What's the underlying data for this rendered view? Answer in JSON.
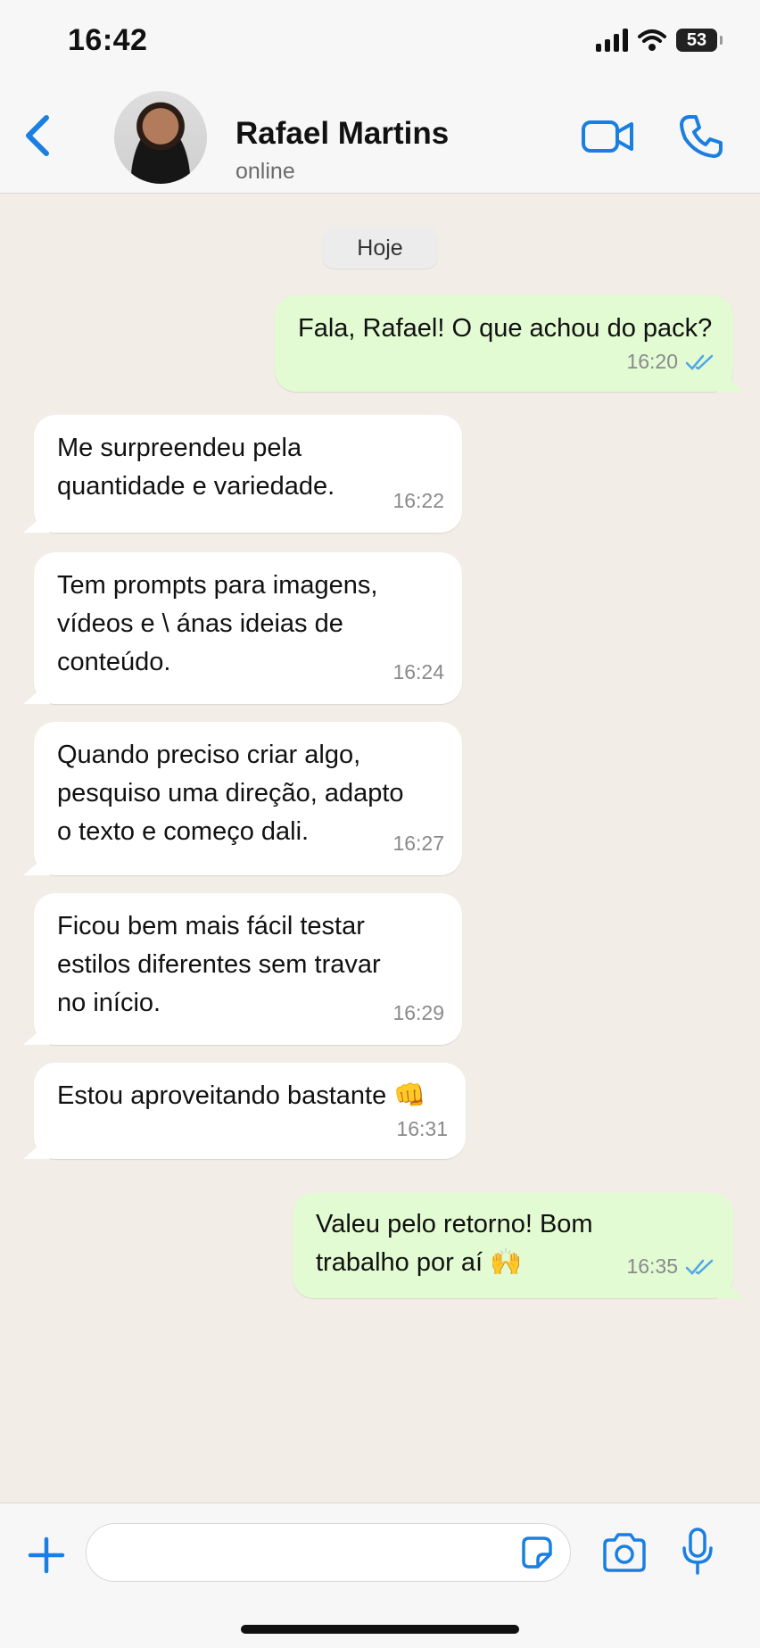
{
  "status_bar": {
    "time": "16:42",
    "battery": "53",
    "signal_icon": "cellular-signal-icon",
    "wifi_icon": "wifi-icon"
  },
  "header": {
    "contact_name": "Rafael Martins",
    "status": "online",
    "back_icon": "chevron-left-icon",
    "video_icon": "video-camera-icon",
    "call_icon": "phone-icon",
    "accent": "#1a7fe0"
  },
  "chat": {
    "date_label": "Hoje",
    "messages": [
      {
        "direction": "out",
        "text": "Fala, Rafael! O que achou do pack?",
        "time": "16:20",
        "read": true
      },
      {
        "direction": "in",
        "text": "Me surpreendeu pela\nquantidade e variedade.",
        "time": "16:22"
      },
      {
        "direction": "in",
        "text": "Tem prompts para imagens,\nvídeos e \\ ánas ideias de\nconteúdo.",
        "time": "16:24"
      },
      {
        "direction": "in",
        "text": "Quando preciso criar algo,\npesquiso uma direção, adapto\no texto e começo dali.",
        "time": "16:27"
      },
      {
        "direction": "in",
        "text": "Ficou bem mais fácil testar\nestilos diferentes sem travar\nno início.",
        "time": "16:29"
      },
      {
        "direction": "in",
        "text": "Estou aproveitando bastante 👊",
        "time": "16:31"
      },
      {
        "direction": "out",
        "text": "Valeu pelo retorno! Bom\ntrabalho por aí 🙌",
        "time": "16:35",
        "read": true
      }
    ],
    "incoming_bubble_color": "#ffffff",
    "outgoing_bubble_color": "#e3fbd3",
    "read_tick_color": "#4fa6e8"
  },
  "composer": {
    "placeholder": "",
    "plus_icon": "plus-icon",
    "sticker_icon": "sticker-icon",
    "camera_icon": "camera-icon",
    "mic_icon": "microphone-icon"
  }
}
